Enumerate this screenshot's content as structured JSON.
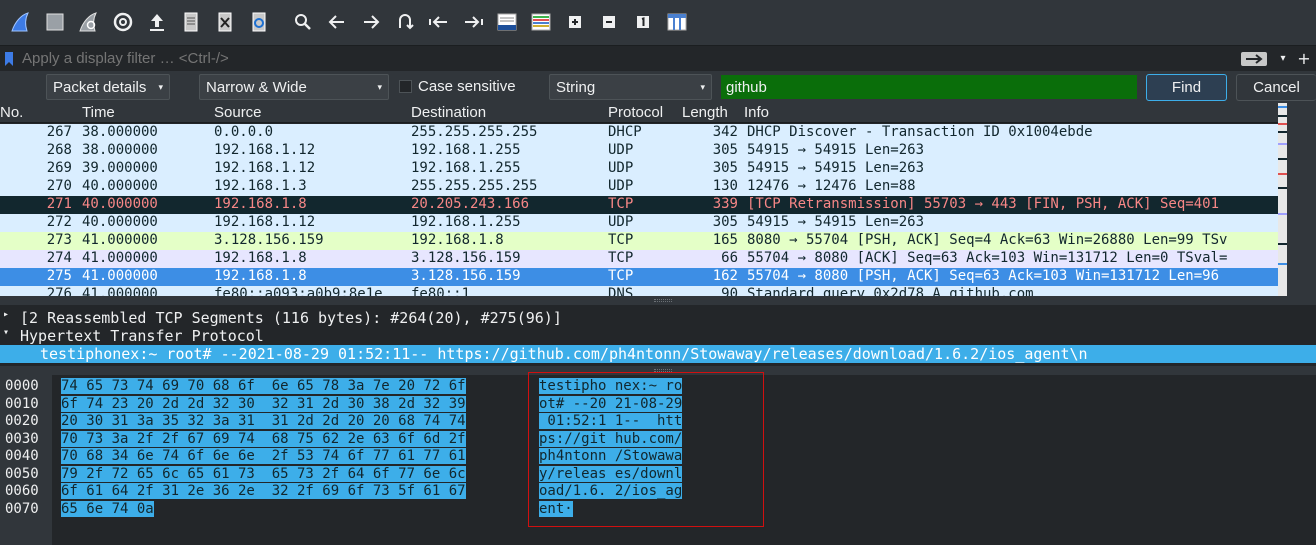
{
  "filter": {
    "placeholder": "Apply a display filter … <Ctrl-/>"
  },
  "find": {
    "search_in": "Packet details",
    "char_width": "Narrow & Wide",
    "case_sensitive_label": "Case sensitive",
    "search_type": "String",
    "query": "github",
    "find_label": "Find",
    "cancel_label": "Cancel"
  },
  "packet_list": {
    "columns": [
      "No.",
      "Time",
      "Source",
      "Destination",
      "Protocol",
      "Length",
      "Info"
    ],
    "rows": [
      {
        "no": "267",
        "time": "38.000000",
        "src": "0.0.0.0",
        "dst": "255.255.255.255",
        "proto": "DHCP",
        "len": "342",
        "info": "DHCP Discover - Transaction ID 0x1004ebde",
        "bg": "#daeeff",
        "fg": "#12272e"
      },
      {
        "no": "268",
        "time": "38.000000",
        "src": "192.168.1.12",
        "dst": "192.168.1.255",
        "proto": "UDP",
        "len": "305",
        "info": "54915 → 54915 Len=263",
        "bg": "#daeeff",
        "fg": "#12272e"
      },
      {
        "no": "269",
        "time": "39.000000",
        "src": "192.168.1.12",
        "dst": "192.168.1.255",
        "proto": "UDP",
        "len": "305",
        "info": "54915 → 54915 Len=263",
        "bg": "#daeeff",
        "fg": "#12272e"
      },
      {
        "no": "270",
        "time": "40.000000",
        "src": "192.168.1.3",
        "dst": "255.255.255.255",
        "proto": "UDP",
        "len": "130",
        "info": "12476 → 12476 Len=88",
        "bg": "#daeeff",
        "fg": "#12272e"
      },
      {
        "no": "271",
        "time": "40.000000",
        "src": "192.168.1.8",
        "dst": "20.205.243.166",
        "proto": "TCP",
        "len": "339",
        "info": "[TCP Retransmission] 55703 → 443 [FIN, PSH, ACK] Seq=401",
        "bg": "#12272e",
        "fg": "#f78787"
      },
      {
        "no": "272",
        "time": "40.000000",
        "src": "192.168.1.12",
        "dst": "192.168.1.255",
        "proto": "UDP",
        "len": "305",
        "info": "54915 → 54915 Len=263",
        "bg": "#daeeff",
        "fg": "#12272e"
      },
      {
        "no": "273",
        "time": "41.000000",
        "src": "3.128.156.159",
        "dst": "192.168.1.8",
        "proto": "TCP",
        "len": "165",
        "info": "8080 → 55704 [PSH, ACK] Seq=4 Ack=63 Win=26880 Len=99 TSv",
        "bg": "#e4ffc7",
        "fg": "#12272e"
      },
      {
        "no": "274",
        "time": "41.000000",
        "src": "192.168.1.8",
        "dst": "3.128.156.159",
        "proto": "TCP",
        "len": "66",
        "info": "55704 → 8080 [ACK] Seq=63 Ack=103 Win=131712 Len=0 TSval=",
        "bg": "#e7e6ff",
        "fg": "#12272e"
      },
      {
        "no": "275",
        "time": "41.000000",
        "src": "192.168.1.8",
        "dst": "3.128.156.159",
        "proto": "TCP",
        "len": "162",
        "info": "55704 → 8080 [PSH, ACK] Seq=63 Ack=103 Win=131712 Len=96",
        "bg": "#3d8ee5",
        "fg": "#ffffff"
      },
      {
        "no": "276",
        "time": "41.000000",
        "src": "fe80::a093:a0b9:8e1e",
        "dst": "fe80::1",
        "proto": "DNS",
        "len": "90",
        "info": "Standard query 0x2d78 A github.com",
        "bg": "#daeeff",
        "fg": "#12272e"
      }
    ]
  },
  "details": {
    "rows": [
      {
        "tri": "▸",
        "text": "[2 Reassembled TCP Segments (116 bytes): #264(20), #275(96)]",
        "indent": "0"
      },
      {
        "tri": "▾",
        "text": "Hypertext Transfer Protocol",
        "indent": "0"
      },
      {
        "tri": "",
        "text": "testiphonex:~ root# --2021-08-29 01:52:11--  https://github.com/ph4ntonn/Stowaway/releases/download/1.6.2/ios_agent\\n",
        "indent": "1"
      }
    ]
  },
  "bytes": {
    "offsets": [
      "0000",
      "0010",
      "0020",
      "0030",
      "0040",
      "0050",
      "0060",
      "0070"
    ],
    "hex": [
      "74 65 73 74 69 70 68 6f  6e 65 78 3a 7e 20 72 6f",
      "6f 74 23 20 2d 2d 32 30  32 31 2d 30 38 2d 32 39",
      "20 30 31 3a 35 32 3a 31  31 2d 2d 20 20 68 74 74",
      "70 73 3a 2f 2f 67 69 74  68 75 62 2e 63 6f 6d 2f",
      "70 68 34 6e 74 6f 6e 6e  2f 53 74 6f 77 61 77 61",
      "79 2f 72 65 6c 65 61 73  65 73 2f 64 6f 77 6e 6c",
      "6f 61 64 2f 31 2e 36 2e  32 2f 69 6f 73 5f 61 67",
      "65 6e 74 0a"
    ],
    "ascii": [
      "testipho nex:~ ro",
      "ot# --20 21-08-29",
      " 01:52:1 1--  htt",
      "ps://git hub.com/",
      "ph4ntonn /Stowawa",
      "y/releas es/downl",
      "oad/1.6. 2/ios_ag",
      "ent·"
    ]
  },
  "colors": {
    "accent": "#3daee9",
    "selected_row": "#3d8ee5",
    "search_match": "#0a6e0a",
    "highlight_box": "#d01010"
  }
}
